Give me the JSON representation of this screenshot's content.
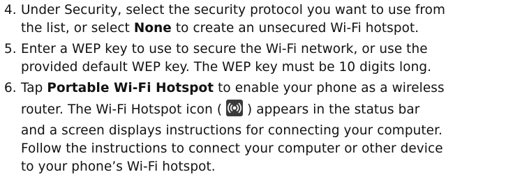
{
  "steps": [
    {
      "number": "4.",
      "line1": {
        "pre": "Under Security, select the security protocol you want to use from"
      },
      "line2": {
        "pre": "the list, or select ",
        "strong": "None",
        "post": " to create an unsecured Wi-Fi hotspot."
      }
    },
    {
      "number": "5.",
      "line1": {
        "pre": "Enter a WEP key to use to secure the Wi-Fi network, or use the"
      },
      "line2": {
        "pre": "provided default WEP key. The WEP key must be 10 digits long."
      }
    },
    {
      "number": "6.",
      "line1": {
        "pre": "Tap ",
        "strong": "Portable Wi-Fi Hotspot",
        "post": " to enable your phone as a wireless"
      },
      "line2": {
        "pre": "router. The Wi-Fi Hotspot icon ( ",
        "icon": "wifi-hotspot-icon",
        "post": " ) appears in the status bar"
      },
      "line3": {
        "pre": "and a screen displays instructions for connecting your computer."
      },
      "line4": {
        "pre": "Follow the instructions to connect your computer or other device"
      },
      "line5": {
        "pre": "to your phone’s Wi-Fi hotspot."
      }
    }
  ],
  "colors": {
    "text": "#111111",
    "icon_bg": "#3a3a3a",
    "icon_glyph": "#ffffff"
  }
}
